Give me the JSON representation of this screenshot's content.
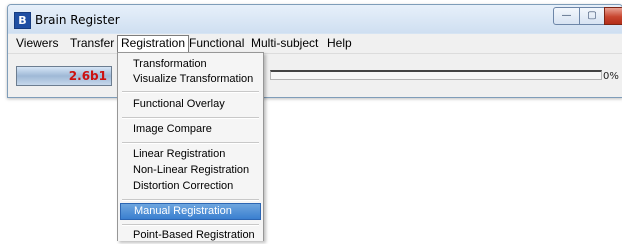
{
  "window": {
    "app_icon_glyph": "B",
    "title": "Brain Register",
    "controls": {
      "minimize_glyph": "—",
      "maximize_glyph": "▢",
      "close_glyph": "✕"
    }
  },
  "menubar": {
    "items": [
      "Viewers",
      "Transfer",
      "Registration",
      "Functional",
      "Multi-subject",
      "Help"
    ],
    "open_item": "Registration"
  },
  "toolbar": {
    "version_label": "2.6b1",
    "progress": {
      "percent": 0,
      "text": "0%"
    }
  },
  "registration_menu": {
    "groups": [
      [
        "Transformation",
        "Visualize Transformation"
      ],
      [
        "Functional Overlay"
      ],
      [
        "Image Compare"
      ],
      [
        "Linear Registration",
        "Non-Linear Registration",
        "Distortion Correction"
      ],
      [
        "Manual Registration"
      ],
      [
        "Point-Based Registration"
      ]
    ],
    "items": {
      "transformation": "Transformation",
      "visualize_transformation": "Visualize Transformation",
      "functional_overlay": "Functional Overlay",
      "image_compare": "Image Compare",
      "linear_registration": "Linear Registration",
      "non_linear_registration": "Non-Linear Registration",
      "distortion_correction": "Distortion Correction",
      "manual_registration": "Manual Registration",
      "point_based_registration": "Point-Based Registration"
    },
    "highlighted": "Manual Registration"
  },
  "colors": {
    "menu_highlight": "#3a7fd0",
    "version_text": "#cc1111",
    "close_button": "#c8452f"
  }
}
